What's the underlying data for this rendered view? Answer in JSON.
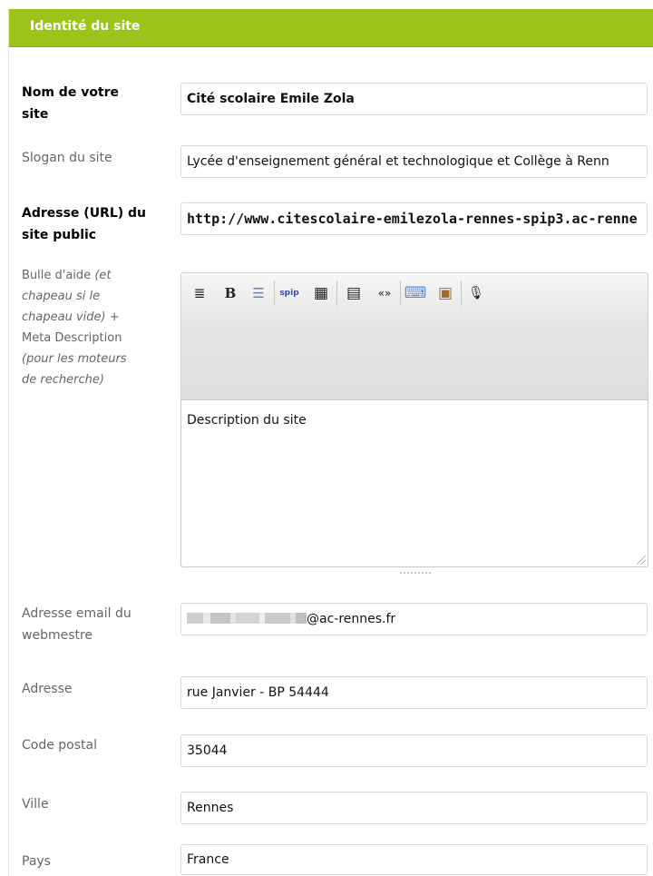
{
  "section": {
    "title": "Identité du site"
  },
  "fields": {
    "nom": {
      "label_line1": "Nom de votre",
      "label_line2": "site",
      "value": "Cité scolaire Emile Zola"
    },
    "slogan": {
      "label": "Slogan du site",
      "value": "Lycée d'enseignement général et technologique et Collège à Renn"
    },
    "url": {
      "label_line1": "Adresse (URL) du",
      "label_line2": "site public",
      "value": "http://www.citescolaire-emilezola-rennes-spip3.ac-renne"
    },
    "description": {
      "label_l1_plain": "Bulle d'aide ",
      "label_l1_em": "(et",
      "label_l2_em": "chapeau si le",
      "label_l3_em": "chapeau vide)",
      "label_l3_plain": " +",
      "label_l4_plain": "Meta Description",
      "label_l5_em": "(pour les moteurs",
      "label_l6_em": "de recherche)",
      "value": "Description du site"
    },
    "email": {
      "label_line1": "Adresse email du",
      "label_line2": "webmestre",
      "value_suffix": "@ac-rennes.fr"
    },
    "adresse": {
      "label": "Adresse",
      "value": "rue Janvier - BP 54444"
    },
    "code_postal": {
      "label": "Code postal",
      "value": "35044"
    },
    "ville": {
      "label": "Ville",
      "value": "Rennes"
    },
    "pays": {
      "label": "Pays",
      "value": "France"
    }
  },
  "toolbar": {
    "align_glyph": "≣",
    "bold_glyph": "B",
    "list_glyph": "☰",
    "spip_glyph": "spip",
    "table_glyph": "▦",
    "frame_glyph": "▤",
    "quote_glyph": "«»",
    "keyboard_glyph": "⌨",
    "preview_glyph": "▣",
    "mic_glyph": "🎙"
  },
  "colors": {
    "header_bg": "#9dc31b",
    "header_text": "#ffffff"
  }
}
